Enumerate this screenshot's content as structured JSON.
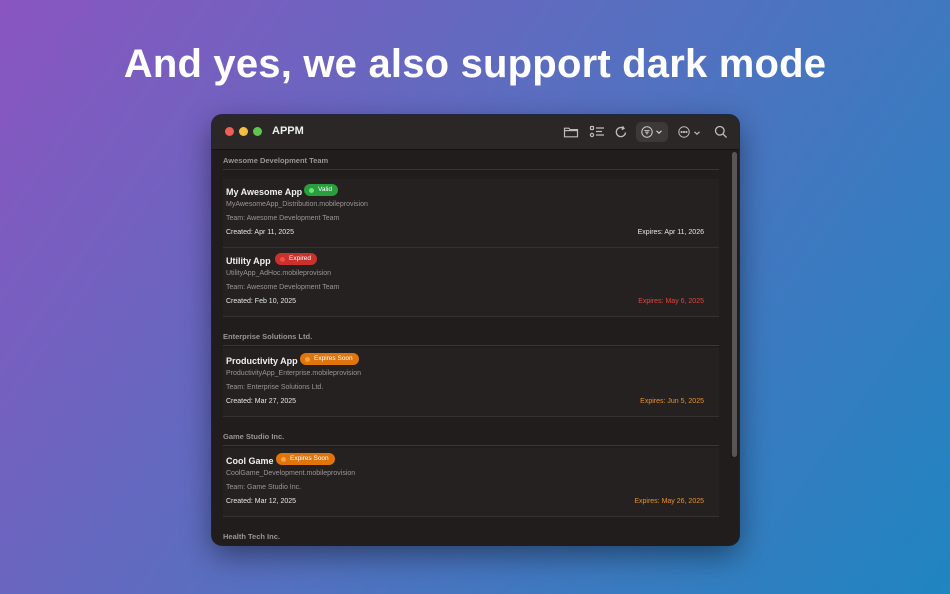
{
  "headline": "And yes, we also support dark mode",
  "window": {
    "title": "APPM",
    "toolbar_icons": [
      "folder-icon",
      "list-icon",
      "refresh-icon",
      "filter-icon",
      "more-icon",
      "search-icon"
    ]
  },
  "colors": {
    "valid": "#2a9d3d",
    "expired": "#c8312c",
    "expires_soon": "#e0750d",
    "expires_normal": "#e6e6e6",
    "expires_expired": "#e0453f",
    "expires_soon_text": "#e8912a"
  },
  "sections": [
    {
      "header": "Awesome Development Team",
      "items": [
        {
          "name": "My Awesome App",
          "status": "Valid",
          "file": "MyAwesomeApp_Distribution.mobileprovision",
          "team": "Team: Awesome Development Team",
          "created": "Created: Apr 11, 2025",
          "expires": "Expires: Apr 11, 2026"
        },
        {
          "name": "Utility App",
          "status": "Expired",
          "file": "UtilityApp_AdHoc.mobileprovision",
          "team": "Team: Awesome Development Team",
          "created": "Created: Feb 10, 2025",
          "expires": "Expires: May 6, 2025"
        }
      ]
    },
    {
      "header": "Enterprise Solutions Ltd.",
      "items": [
        {
          "name": "Productivity App",
          "status": "Expires Soon",
          "file": "ProductivityApp_Enterprise.mobileprovision",
          "team": "Team: Enterprise Solutions Ltd.",
          "created": "Created: Mar 27, 2025",
          "expires": "Expires: Jun 5, 2025"
        }
      ]
    },
    {
      "header": "Game Studio Inc.",
      "items": [
        {
          "name": "Cool Game",
          "status": "Expires Soon",
          "file": "CoolGame_Development.mobileprovision",
          "team": "Team: Game Studio Inc.",
          "created": "Created: Mar 12, 2025",
          "expires": "Expires: May 26, 2025"
        }
      ]
    },
    {
      "header": "Health Tech Inc.",
      "items": []
    }
  ]
}
